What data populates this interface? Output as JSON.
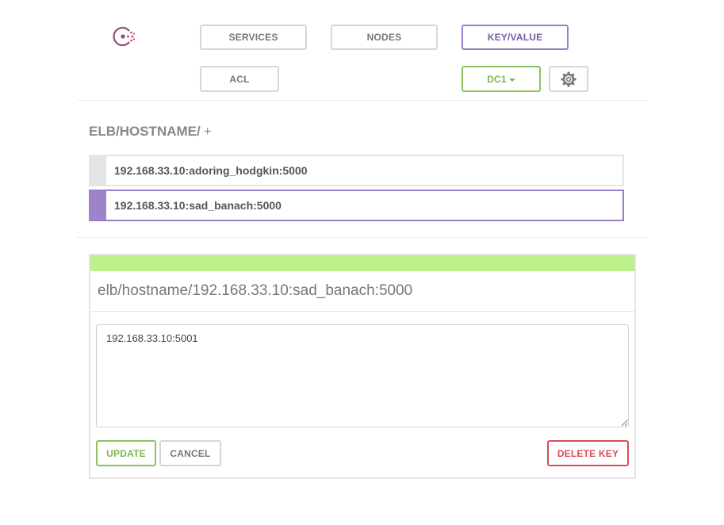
{
  "nav": {
    "logo_icon": "consul-logo-icon",
    "services": "SERVICES",
    "nodes": "NODES",
    "keyvalue": "KEY/VALUE",
    "acl": "ACL",
    "dc": "DC1",
    "settings_icon": "gear-icon"
  },
  "breadcrumb": {
    "path": "ELB/HOSTNAME/",
    "add": "+"
  },
  "keys": [
    {
      "label": "192.168.33.10:adoring_hodgkin:5000",
      "selected": false
    },
    {
      "label": "192.168.33.10:sad_banach:5000",
      "selected": true
    }
  ],
  "editor": {
    "status_color": "#bdf08a",
    "key_path": "elb/hostname/192.168.33.10:sad_banach:5000",
    "value": "192.168.33.10:5001",
    "update": "UPDATE",
    "cancel": "CANCEL",
    "delete": "DELETE KEY"
  },
  "colors": {
    "accent_purple": "#9a7ec8",
    "accent_green": "#8bc35f",
    "danger_red": "#d94d5a"
  }
}
